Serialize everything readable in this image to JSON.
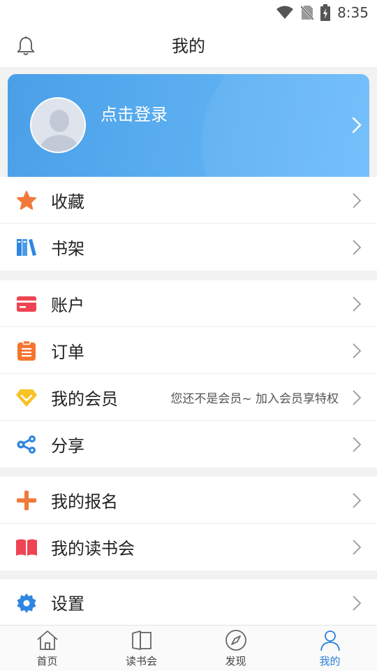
{
  "status_bar": {
    "time": "8:35",
    "icons": [
      "wifi-icon",
      "no-sim-icon",
      "battery-charging-icon"
    ]
  },
  "header": {
    "title": "我的",
    "left_icon": "bell-icon"
  },
  "profile": {
    "login_label": "点击登录",
    "avatar_icon": "default-avatar-icon",
    "gradient_start": "#4a9fe8",
    "gradient_end": "#6ebcfc"
  },
  "menu_groups": [
    {
      "items": [
        {
          "label": "收藏",
          "icon": "star-icon",
          "color": "#f07a3a"
        },
        {
          "label": "书架",
          "icon": "bookshelf-icon",
          "color": "#2f86e0"
        }
      ]
    },
    {
      "items": [
        {
          "label": "账户",
          "icon": "card-icon",
          "color": "#ee4453"
        },
        {
          "label": "订单",
          "icon": "clipboard-icon",
          "color": "#f5752f"
        },
        {
          "label": "我的会员",
          "icon": "diamond-icon",
          "color": "#f8c326",
          "extra": "您还不是会员~ 加入会员享特权"
        },
        {
          "label": "分享",
          "icon": "share-icon",
          "color": "#2f86e0"
        }
      ]
    },
    {
      "items": [
        {
          "label": "我的报名",
          "icon": "plus-icon",
          "color": "#f07a3a"
        },
        {
          "label": "我的读书会",
          "icon": "open-book-icon",
          "color": "#ee4453"
        }
      ]
    },
    {
      "items": [
        {
          "label": "设置",
          "icon": "gear-icon",
          "color": "#2f86e0"
        }
      ]
    }
  ],
  "tabs": [
    {
      "label": "首页",
      "icon": "home-icon",
      "active": false
    },
    {
      "label": "读书会",
      "icon": "book-icon",
      "active": false
    },
    {
      "label": "发现",
      "icon": "compass-icon",
      "active": false
    },
    {
      "label": "我的",
      "icon": "person-icon",
      "active": true
    }
  ],
  "colors": {
    "accent": "#2a7fd8",
    "text": "#222222",
    "muted": "#555555"
  }
}
